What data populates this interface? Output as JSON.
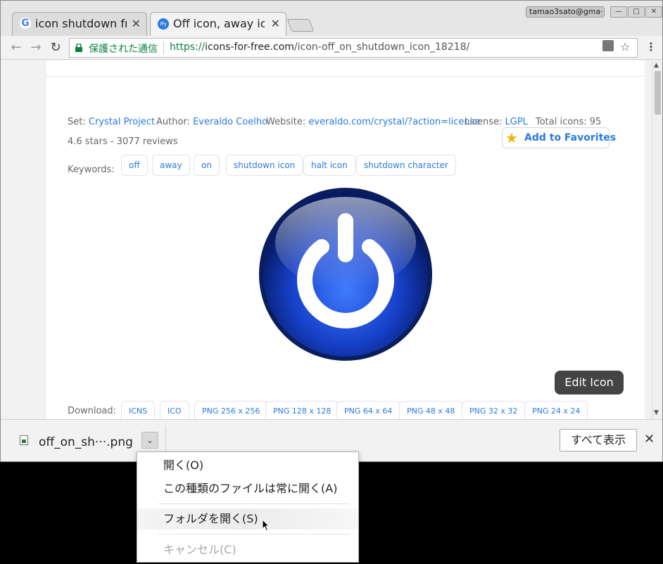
{
  "browser": {
    "account_label": "tamao3sato@gma···",
    "tabs": [
      {
        "title": "icon shutdown fre",
        "favicon": "google-g-icon"
      },
      {
        "title": "Off icon, away ico",
        "favicon": "icons-for-free-icon"
      }
    ],
    "omnibox": {
      "secure_label": "保護された通信",
      "url_scheme": "https://",
      "url_host": "icons-for-free.com",
      "url_path": "/icon-off_on_shutdown_icon_18218/"
    }
  },
  "page": {
    "set_label": "Set:",
    "set_value": "Crystal Project",
    "author_label": "Author:",
    "author_value": "Everaldo Coelho",
    "website_label": "Website:",
    "website_value": "everaldo.com/crystal/?action=license",
    "license_label": "License:",
    "license_value": "LGPL",
    "total_icons": "Total icons: 95",
    "rating": "4.6 stars - 3077 reviews",
    "add_favorites": "Add to Favorites",
    "keywords_label": "Keywords:",
    "keywords": [
      "off",
      "away",
      "on",
      "shutdown icon",
      "halt icon",
      "shutdown character"
    ],
    "edit_icon": "Edit Icon",
    "download_label": "Download:",
    "downloads": [
      "ICNS",
      "ICO",
      "PNG 256 x 256",
      "PNG 128 x 128",
      "PNG 64 x 64",
      "PNG 48 x 48",
      "PNG 32 x 32",
      "PNG 24 x 24"
    ]
  },
  "download_shelf": {
    "filename": "off_on_sh···.png",
    "show_all": "すべて表示"
  },
  "context_menu": {
    "items": [
      {
        "label": "開く(O)",
        "state": "normal"
      },
      {
        "label": "この種類のファイルは常に開く(A)",
        "state": "normal"
      },
      {
        "label": "フォルダを開く(S)",
        "state": "highlighted"
      },
      {
        "label": "キャンセル(C)",
        "state": "disabled"
      }
    ]
  },
  "colors": {
    "link": "#2a7ae2",
    "secure_green": "#0b8043",
    "power_blue": "#1a4fd6"
  }
}
